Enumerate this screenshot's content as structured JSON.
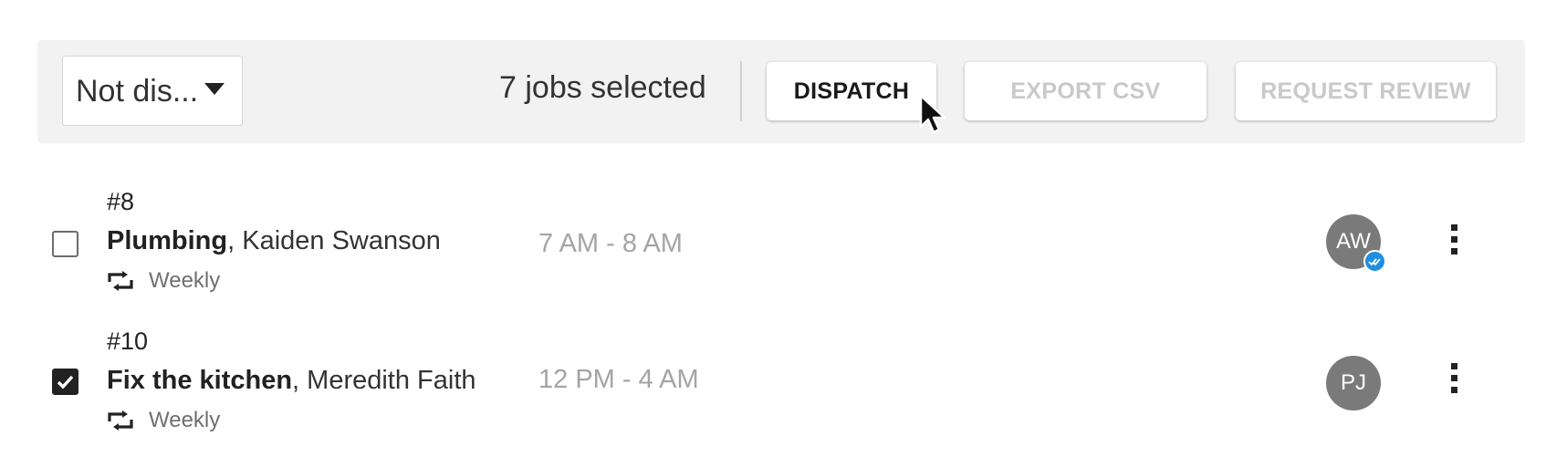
{
  "toolbar": {
    "status_filter": "Not dis...",
    "selected_count_text": "7 jobs selected",
    "dispatch_label": "DISPATCH",
    "export_label": "EXPORT CSV",
    "review_label": "REQUEST REVIEW"
  },
  "jobs": [
    {
      "number": "#8",
      "service": "Plumbing",
      "customer": ", Kaiden Swanson",
      "recurrence": "Weekly",
      "time": "7 AM - 8 AM",
      "assignee_initials": "AW",
      "assignee_verified": true,
      "checked": false
    },
    {
      "number": "#10",
      "service": "Fix the kitchen",
      "customer": ", Meredith Faith",
      "recurrence": "Weekly",
      "time": "12 PM - 4 AM",
      "assignee_initials": "PJ",
      "assignee_verified": false,
      "checked": true
    }
  ],
  "colors": {
    "toolbar_bg": "#f2f2f2",
    "disabled_text": "#c9c9c9",
    "avatar_bg": "#7a7a7a",
    "verified_badge": "#1e8fe0"
  }
}
